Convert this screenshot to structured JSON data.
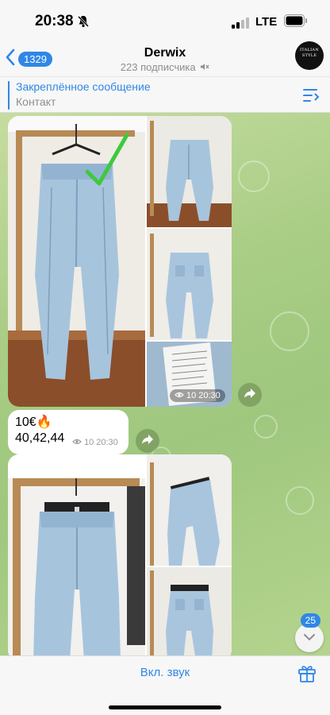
{
  "status_bar": {
    "time": "20:38",
    "network": "LTE"
  },
  "header": {
    "back_count": "1329",
    "title": "Derwix",
    "subtitle": "223 подписчика",
    "avatar_text": "ITALIAN STYLE"
  },
  "pinned": {
    "title": "Закреплённое сообщение",
    "text": "Контакт"
  },
  "messages": [
    {
      "type": "album",
      "views": "10",
      "time": "20:30"
    },
    {
      "type": "text",
      "line1": "10€🔥",
      "line2": "40,42,44",
      "views": "10",
      "time": "20:30"
    },
    {
      "type": "album"
    }
  ],
  "unread_count": "25",
  "bottom_bar": {
    "unmute_label": "Вкл. звук"
  },
  "colors": {
    "accent": "#2f87e6",
    "chat_bg": "#a9cd85",
    "denim": "#9ec0dd"
  },
  "icons": [
    "bell-slash-icon",
    "signal-icon",
    "battery-icon",
    "back-chevron-icon",
    "mute-icon",
    "pinned-list-icon",
    "eye-icon",
    "share-arrow-icon",
    "chevron-down-icon",
    "gift-icon"
  ]
}
